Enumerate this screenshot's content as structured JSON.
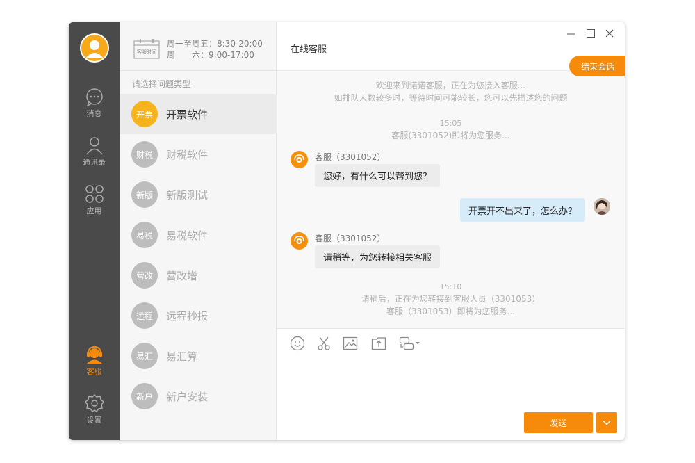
{
  "colors": {
    "accent": "#f58a0b",
    "badge_active": "#f7b31b",
    "badge_idle": "#bdbdbd",
    "rail_bg": "#4a4a4a",
    "user_bubble": "#d6ecf8"
  },
  "nav": {
    "items": [
      {
        "icon": "chat-bubble-icon",
        "label": "消息"
      },
      {
        "icon": "contacts-icon",
        "label": "通讯录"
      },
      {
        "icon": "apps-icon",
        "label": "应用"
      },
      {
        "icon": "customer-service-icon",
        "label": "客服"
      },
      {
        "icon": "gear-icon",
        "label": "设置"
      }
    ]
  },
  "hours": {
    "calendar_label": "客服时间",
    "weekday": "周一至周五：8:30-20:00",
    "saturday": "周　　六：9:00-17:00"
  },
  "categories": {
    "prompt": "请选择问题类型",
    "items": [
      {
        "badge": "开票",
        "name": "开票软件"
      },
      {
        "badge": "财税",
        "name": "财税软件"
      },
      {
        "badge": "新版",
        "name": "新版测试"
      },
      {
        "badge": "易税",
        "name": "易税软件"
      },
      {
        "badge": "营改",
        "name": "营改增"
      },
      {
        "badge": "远程",
        "name": "远程抄报"
      },
      {
        "badge": "易汇",
        "name": "易汇算"
      },
      {
        "badge": "新户",
        "name": "新户安装"
      }
    ]
  },
  "chat": {
    "title": "在线客服",
    "welcome_line1": "欢迎来到诺诺客服，正在为您接入客服...",
    "welcome_line2": "如排队人数较多时，等待时间可能较长，您可以先描述您的问题",
    "end_button": "结束会话",
    "time1": "15:05",
    "sys_serving1": "客服(3301052)即将为您服务...",
    "agent1_name": "客服（3301052）",
    "agent1_msg": "您好，有什么可以帮到您？",
    "user_msg": "开票开不出来了，怎么办？",
    "agent2_name": "客服（3301052）",
    "agent2_msg": "请稍等，为您转接相关客服",
    "time2": "15:10",
    "transfer_line1": "请稍后，正在为您转接到客服人员（3301053）",
    "transfer_line2": "客服（3301053）即将为您服务..."
  },
  "toolbar": {
    "tools": [
      "emoji-icon",
      "scissors-icon",
      "image-icon",
      "upload-file-icon",
      "transfer-icon"
    ]
  },
  "send": {
    "label": "发送"
  }
}
